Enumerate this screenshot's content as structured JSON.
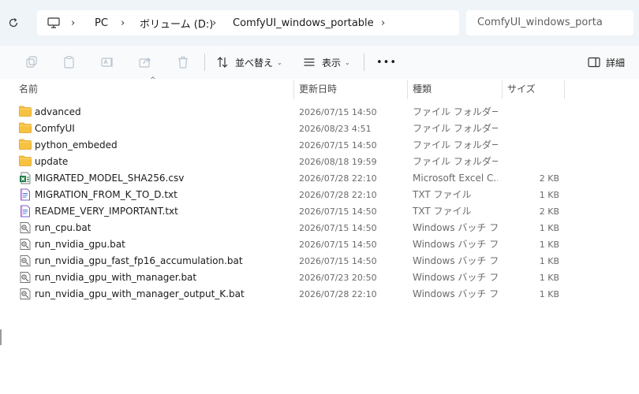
{
  "address_bar": {
    "crumbs": [
      {
        "label": "PC"
      },
      {
        "label": "ボリューム (D:)"
      },
      {
        "label": "ComfyUI_windows_portable"
      }
    ],
    "search_placeholder": "ComfyUI_windows_porta"
  },
  "command_bar": {
    "sort_label": "並べ替え",
    "view_label": "表示",
    "more_label": "•••",
    "details_label": "詳細"
  },
  "columns": {
    "name": "名前",
    "date": "更新日時",
    "type": "種類",
    "size": "サイズ"
  },
  "files": [
    {
      "name": "advanced",
      "date": "2026/07/15 14:50",
      "type": "ファイル フォルダー",
      "size": "",
      "icon": "folder-icon"
    },
    {
      "name": "ComfyUI",
      "date": "2026/08/23 4:51",
      "type": "ファイル フォルダー",
      "size": "",
      "icon": "folder-icon"
    },
    {
      "name": "python_embeded",
      "date": "2026/07/15 14:50",
      "type": "ファイル フォルダー",
      "size": "",
      "icon": "folder-icon"
    },
    {
      "name": "update",
      "date": "2026/08/18 19:59",
      "type": "ファイル フォルダー",
      "size": "",
      "icon": "folder-icon"
    },
    {
      "name": "MIGRATED_MODEL_SHA256.csv",
      "date": "2026/07/28 22:10",
      "type": "Microsoft Excel C...",
      "size": "2 KB",
      "icon": "excel-file-icon"
    },
    {
      "name": "MIGRATION_FROM_K_TO_D.txt",
      "date": "2026/07/28 22:10",
      "type": "TXT ファイル",
      "size": "1 KB",
      "icon": "text-file-icon"
    },
    {
      "name": "README_VERY_IMPORTANT.txt",
      "date": "2026/07/15 14:50",
      "type": "TXT ファイル",
      "size": "2 KB",
      "icon": "text-file-icon"
    },
    {
      "name": "run_cpu.bat",
      "date": "2026/07/15 14:50",
      "type": "Windows バッチ ファ...",
      "size": "1 KB",
      "icon": "batch-file-icon"
    },
    {
      "name": "run_nvidia_gpu.bat",
      "date": "2026/07/15 14:50",
      "type": "Windows バッチ ファ...",
      "size": "1 KB",
      "icon": "batch-file-icon"
    },
    {
      "name": "run_nvidia_gpu_fast_fp16_accumulation.bat",
      "date": "2026/07/15 14:50",
      "type": "Windows バッチ ファ...",
      "size": "1 KB",
      "icon": "batch-file-icon"
    },
    {
      "name": "run_nvidia_gpu_with_manager.bat",
      "date": "2026/07/23 20:50",
      "type": "Windows バッチ ファ...",
      "size": "1 KB",
      "icon": "batch-file-icon"
    },
    {
      "name": "run_nvidia_gpu_with_manager_output_K.bat",
      "date": "2026/07/28 22:10",
      "type": "Windows バッチ ファ...",
      "size": "1 KB",
      "icon": "batch-file-icon"
    }
  ]
}
